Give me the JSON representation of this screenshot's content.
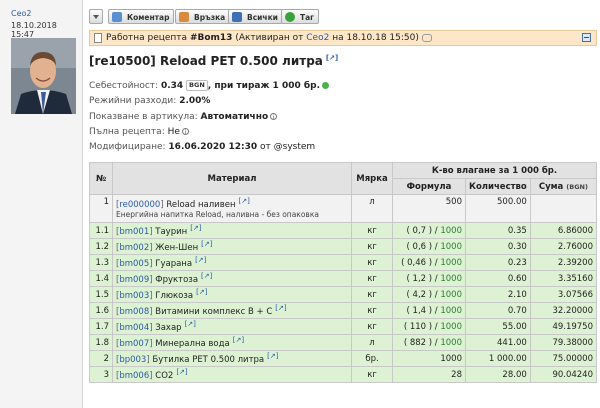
{
  "author": {
    "name": "Ceo2",
    "date": "18.10.2018 15:47"
  },
  "toolbar": {
    "comment": "Коментар",
    "link": "Връзка",
    "all": "Всички",
    "tag": "Таг"
  },
  "header_bar": {
    "prefix": "Работна рецепта",
    "ref": "#Bom13",
    "open": "(Активиран от",
    "user": "Ceo2",
    "on": "на",
    "when": "18.10.18 15:50)"
  },
  "title": "[re10500] Reload PET 0.500 литра",
  "props": {
    "cost_label": "Себестойност:",
    "cost_value": "0.34",
    "cost_currency": "BGN",
    "cost_rest": ", при тираж 1 000 бр.",
    "overhead_label": "Режийни разходи:",
    "overhead_value": "2.00%",
    "show_label": "Показване в артикула:",
    "show_value": "Автоматично",
    "full_label": "Пълна рецепта:",
    "full_value": "Не",
    "mod_label": "Модифициране:",
    "mod_value": "16.06.2020 12:30",
    "mod_by": "от @system"
  },
  "table": {
    "headers": {
      "no": "№",
      "material": "Материал",
      "unit": "Мярка",
      "group": "К-во влагане за 1 000 бр.",
      "formula": "Формула",
      "qty": "Количество",
      "sum": "Сума",
      "currency": "(BGN)"
    },
    "rows": [
      {
        "no": "1",
        "code": "re000000",
        "name": "Reload наливен",
        "desc": "Енергийна напитка Reload, наливна - без опаковка",
        "unit": "л",
        "formula": "500",
        "qty": "500.00",
        "sum": ""
      },
      {
        "no": "1.1",
        "code": "bm001",
        "name": "Таурин",
        "unit": "кг",
        "f_a": "( 0,7 ) /",
        "f_b": "1000",
        "qty": "0.35",
        "sum": "6.86000"
      },
      {
        "no": "1.2",
        "code": "bm002",
        "name": "Жен-Шен",
        "unit": "кг",
        "f_a": "( 0,6 ) /",
        "f_b": "1000",
        "qty": "0.30",
        "sum": "2.76000"
      },
      {
        "no": "1.3",
        "code": "bm005",
        "name": "Гуарана",
        "unit": "кг",
        "f_a": "( 0,46 ) /",
        "f_b": "1000",
        "qty": "0.23",
        "sum": "2.39200"
      },
      {
        "no": "1.4",
        "code": "bm009",
        "name": "Фруктоза",
        "unit": "кг",
        "f_a": "( 1,2 ) /",
        "f_b": "1000",
        "qty": "0.60",
        "sum": "3.35160"
      },
      {
        "no": "1.5",
        "code": "bm003",
        "name": "Глюкоза",
        "unit": "кг",
        "f_a": "( 4,2 ) /",
        "f_b": "1000",
        "qty": "2.10",
        "sum": "3.07566"
      },
      {
        "no": "1.6",
        "code": "bm008",
        "name": "Витамини комплекс B + C",
        "unit": "кг",
        "f_a": "( 1,4 ) /",
        "f_b": "1000",
        "qty": "0.70",
        "sum": "32.20000"
      },
      {
        "no": "1.7",
        "code": "bm004",
        "name": "Захар",
        "unit": "кг",
        "f_a": "( 110 ) /",
        "f_b": "1000",
        "qty": "55.00",
        "sum": "49.19750"
      },
      {
        "no": "1.8",
        "code": "bm007",
        "name": "Минерална вода",
        "unit": "л",
        "f_a": "( 882 ) /",
        "f_b": "1000",
        "qty": "441.00",
        "sum": "79.38000"
      },
      {
        "no": "2",
        "code": "bp003",
        "name": "Бутилка PET 0.500 литра",
        "unit": "бр.",
        "f_a": "1000",
        "f_b": "",
        "qty": "1 000.00",
        "sum": "75.00000"
      },
      {
        "no": "3",
        "code": "bm006",
        "name": "CO2",
        "unit": "кг",
        "f_a": "28",
        "f_b": "",
        "qty": "28.00",
        "sum": "90.04240"
      }
    ]
  },
  "colors": {
    "green_row": "#dcf2d3",
    "bar_bg": "#fde7c8",
    "link": "#2b5aa8"
  }
}
